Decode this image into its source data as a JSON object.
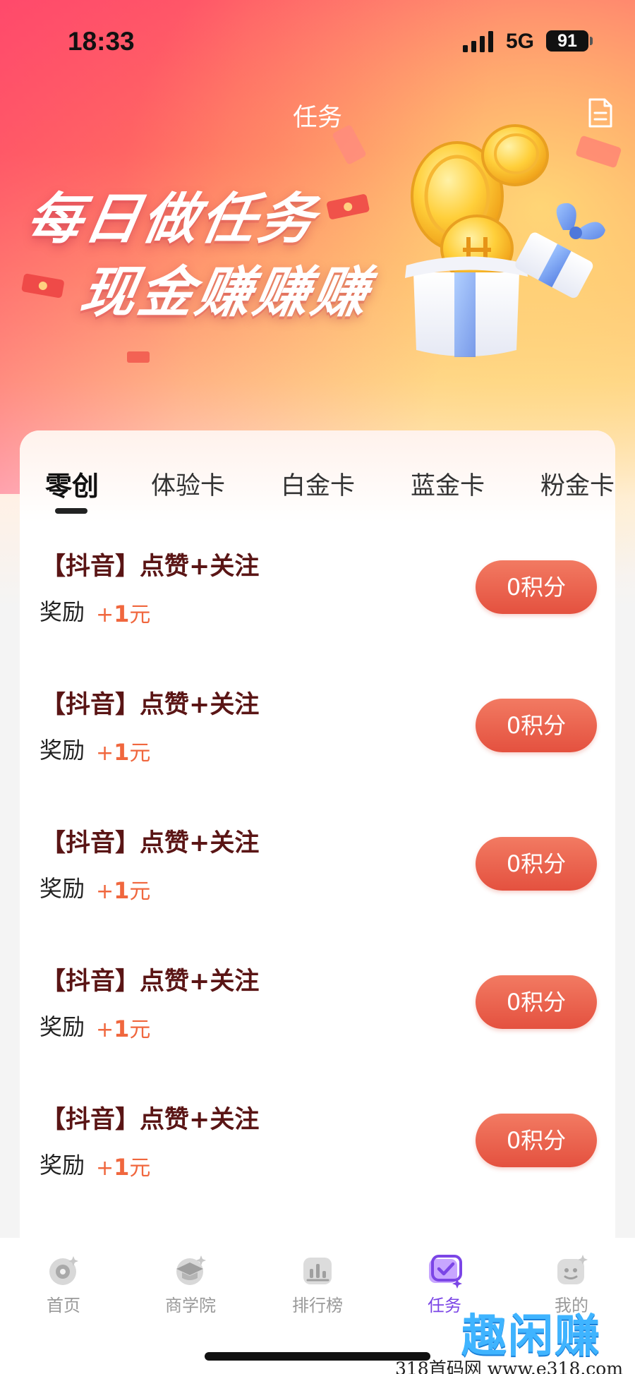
{
  "status_bar": {
    "time": "18:33",
    "network": "5G",
    "battery": "91"
  },
  "nav": {
    "title": "任务",
    "right_icon": "document-icon"
  },
  "banner": {
    "line1": "每日做任务",
    "line2": "现金赚赚赚"
  },
  "tabs": [
    {
      "label": "零创",
      "active": true
    },
    {
      "label": "体验卡",
      "active": false
    },
    {
      "label": "白金卡",
      "active": false
    },
    {
      "label": "蓝金卡",
      "active": false
    },
    {
      "label": "粉金卡",
      "active": false
    }
  ],
  "tasks": [
    {
      "title": "【抖音】点赞+关注",
      "reward_label": "奖励",
      "reward_prefix": "+",
      "reward_amount": "1",
      "reward_unit": "元",
      "button": "0积分"
    },
    {
      "title": "【抖音】点赞+关注",
      "reward_label": "奖励",
      "reward_prefix": "+",
      "reward_amount": "1",
      "reward_unit": "元",
      "button": "0积分"
    },
    {
      "title": "【抖音】点赞+关注",
      "reward_label": "奖励",
      "reward_prefix": "+",
      "reward_amount": "1",
      "reward_unit": "元",
      "button": "0积分"
    },
    {
      "title": "【抖音】点赞+关注",
      "reward_label": "奖励",
      "reward_prefix": "+",
      "reward_amount": "1",
      "reward_unit": "元",
      "button": "0积分"
    },
    {
      "title": "【抖音】点赞+关注",
      "reward_label": "奖励",
      "reward_prefix": "+",
      "reward_amount": "1",
      "reward_unit": "元",
      "button": "0积分"
    }
  ],
  "tabbar": [
    {
      "label": "首页",
      "icon": "home-icon",
      "active": false
    },
    {
      "label": "商学院",
      "icon": "academy-icon",
      "active": false
    },
    {
      "label": "排行榜",
      "icon": "ranking-icon",
      "active": false
    },
    {
      "label": "任务",
      "icon": "task-icon",
      "active": true
    },
    {
      "label": "我的",
      "icon": "profile-icon",
      "active": false
    }
  ],
  "watermark": {
    "logo": "趣闲赚",
    "text": "318首码网 www.e318.com"
  },
  "colors": {
    "accent": "#e4513f",
    "reward": "#f0673e",
    "task_title": "#5a1515",
    "tab_active": "#7b45e6"
  }
}
